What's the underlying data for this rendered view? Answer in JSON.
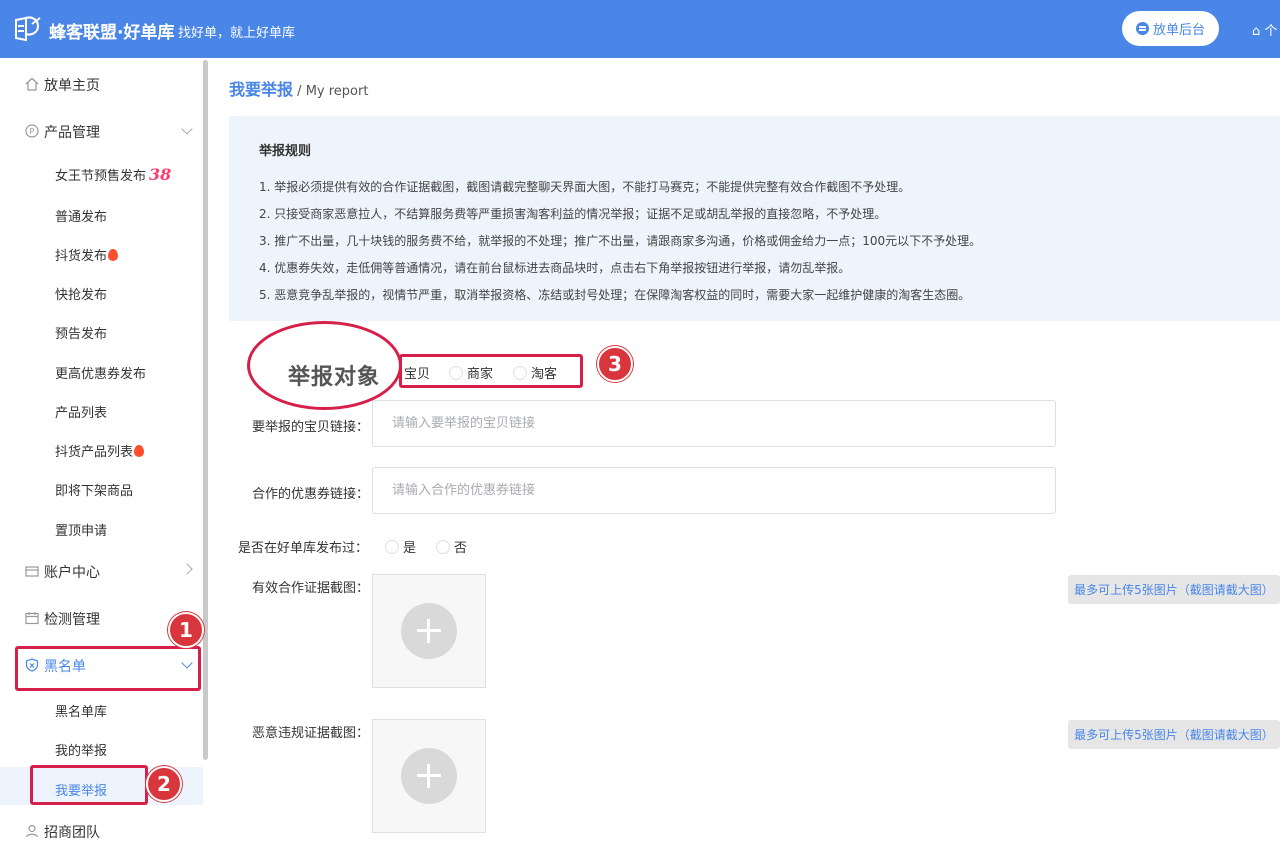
{
  "header": {
    "brand": "蜂客联盟·好单库",
    "slogan": "找好单，就上好单库",
    "admin_button": "放单后台",
    "home_link": "个",
    "logo_icon": "bee-logo-icon",
    "bg_color": "#4a86e8"
  },
  "sidebar": {
    "items": [
      {
        "label": "放单主页",
        "icon": "home-icon"
      },
      {
        "label": "产品管理",
        "icon": "product-p-icon"
      },
      {
        "label": "账户中心",
        "icon": "card-icon"
      },
      {
        "label": "检测管理",
        "icon": "calendar-icon"
      },
      {
        "label": "黑名单",
        "icon": "shield-icon"
      },
      {
        "label": "招商团队",
        "icon": "user-icon"
      }
    ],
    "product_subs": [
      "女王节预售发布",
      "普通发布",
      "抖货发布",
      "快抢发布",
      "预告发布",
      "更高优惠券发布",
      "产品列表",
      "抖货产品列表",
      "即将下架商品",
      "置顶申请"
    ],
    "badge_38": "38",
    "blacklist_subs": [
      "黑名单库",
      "我的举报",
      "我要举报"
    ]
  },
  "breadcrumb": {
    "current": "我要举报",
    "separator": "/",
    "english": "My report"
  },
  "rules": {
    "title": "举报规则",
    "items": [
      "1. 举报必须提供有效的合作证据截图，截图请截完整聊天界面大图，不能打马赛克；不能提供完整有效合作截图不予处理。",
      "2. 只接受商家恶意拉人，不结算服务费等严重损害淘客利益的情况举报；证据不足或胡乱举报的直接忽略，不予处理。",
      "3. 推广不出量，几十块钱的服务费不给，就举报的不处理；推广不出量，请跟商家多沟通，价格或佣金给力一点；100元以下不予处理。",
      "4. 优惠券失效，走低佣等普通情况，请在前台鼠标进去商品块时，点击右下角举报按钮进行举报，请勿乱举报。",
      "5. 恶意竞争乱举报的，视情节严重，取消举报资格、冻结或封号处理；在保障淘客权益的同时，需要大家一起维护健康的淘客生态圈。"
    ]
  },
  "form": {
    "target_label": "举报对象",
    "target_options": [
      "宝贝",
      "商家",
      "淘客"
    ],
    "item_link_label": "要举报的宝贝链接：",
    "item_link_placeholder": "请输入要举报的宝贝链接",
    "coupon_link_label": "合作的优惠券链接：",
    "coupon_link_placeholder": "请输入合作的优惠券链接",
    "published_label": "是否在好单库发布过：",
    "published_options": [
      "是",
      "否"
    ],
    "evidence_label": "有效合作证据截图：",
    "violation_label": "恶意违规证据截图：",
    "upload_hint": "最多可上传5张图片（截图请截大图）"
  },
  "annotations": {
    "markers": [
      "1",
      "2",
      "3"
    ],
    "color": "#d6204a"
  }
}
